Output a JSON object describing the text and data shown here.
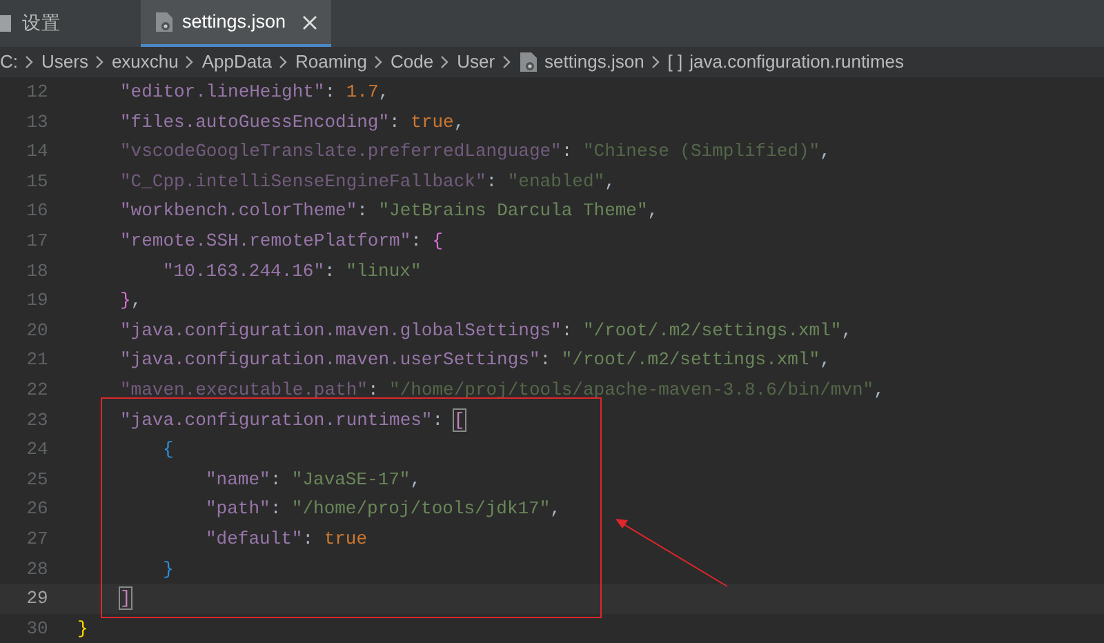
{
  "tabs": [
    {
      "label": "设置",
      "selected": false
    },
    {
      "label": "settings.json",
      "selected": true
    }
  ],
  "breadcrumb": [
    {
      "kind": "text",
      "label": "C:"
    },
    {
      "kind": "text",
      "label": "Users"
    },
    {
      "kind": "text",
      "label": "exuxchu"
    },
    {
      "kind": "text",
      "label": "AppData"
    },
    {
      "kind": "text",
      "label": "Roaming"
    },
    {
      "kind": "text",
      "label": "Code"
    },
    {
      "kind": "text",
      "label": "User"
    },
    {
      "kind": "file",
      "label": "settings.json"
    },
    {
      "kind": "symbol",
      "symbol": "[ ]",
      "label": "java.configuration.runtimes"
    }
  ],
  "editor": {
    "lines": [
      {
        "number": "12",
        "current": false,
        "tokens": [
          {
            "kind": "key",
            "text": "\"editor.lineHeight\""
          },
          {
            "kind": "punct",
            "text": ": "
          },
          {
            "kind": "number",
            "text": "1.7"
          },
          {
            "kind": "punct",
            "text": ","
          }
        ]
      },
      {
        "number": "13",
        "current": false,
        "tokens": [
          {
            "kind": "key",
            "text": "\"files.autoGuessEncoding\""
          },
          {
            "kind": "punct",
            "text": ": "
          },
          {
            "kind": "bool",
            "text": "true"
          },
          {
            "kind": "punct",
            "text": ","
          }
        ]
      },
      {
        "number": "14",
        "current": false,
        "dimmed": true,
        "tokens": [
          {
            "kind": "key",
            "text": "\"vscodeGoogleTranslate.preferredLanguage\""
          },
          {
            "kind": "punct",
            "text": ": "
          },
          {
            "kind": "string",
            "text": "\"Chinese (Simplified)\""
          },
          {
            "kind": "punct",
            "text": ","
          }
        ]
      },
      {
        "number": "15",
        "current": false,
        "dimmed": true,
        "tokens": [
          {
            "kind": "key",
            "text": "\"C_Cpp.intelliSenseEngineFallback\""
          },
          {
            "kind": "punct",
            "text": ": "
          },
          {
            "kind": "string",
            "text": "\"enabled\""
          },
          {
            "kind": "punct",
            "text": ","
          }
        ]
      },
      {
        "number": "16",
        "current": false,
        "tokens": [
          {
            "kind": "key",
            "text": "\"workbench.colorTheme\""
          },
          {
            "kind": "punct",
            "text": ": "
          },
          {
            "kind": "string",
            "text": "\"JetBrains Darcula Theme\""
          },
          {
            "kind": "punct",
            "text": ","
          }
        ]
      },
      {
        "number": "17",
        "current": false,
        "tokens": [
          {
            "kind": "key",
            "text": "\"remote.SSH.remotePlatform\""
          },
          {
            "kind": "punct",
            "text": ": "
          },
          {
            "kind": "open",
            "text": "{",
            "color": "#da70d6"
          }
        ]
      },
      {
        "number": "18",
        "current": false,
        "tokens": [
          {
            "kind": "key",
            "text": "\"10.163.244.16\""
          },
          {
            "kind": "punct",
            "text": ": "
          },
          {
            "kind": "string",
            "text": "\"linux\""
          }
        ]
      },
      {
        "number": "19",
        "current": false,
        "tokens": [
          {
            "kind": "close",
            "text": "}",
            "color": "#da70d6"
          },
          {
            "kind": "punct",
            "text": ","
          }
        ]
      },
      {
        "number": "20",
        "current": false,
        "tokens": [
          {
            "kind": "key",
            "text": "\"java.configuration.maven.globalSettings\""
          },
          {
            "kind": "punct",
            "text": ": "
          },
          {
            "kind": "string",
            "text": "\"/root/.m2/settings.xml\""
          },
          {
            "kind": "punct",
            "text": ","
          }
        ]
      },
      {
        "number": "21",
        "current": false,
        "tokens": [
          {
            "kind": "key",
            "text": "\"java.configuration.maven.userSettings\""
          },
          {
            "kind": "punct",
            "text": ": "
          },
          {
            "kind": "string",
            "text": "\"/root/.m2/settings.xml\""
          },
          {
            "kind": "punct",
            "text": ","
          }
        ]
      },
      {
        "number": "22",
        "current": false,
        "dimmed": true,
        "tokens": [
          {
            "kind": "key",
            "text": "\"maven.executable.path\""
          },
          {
            "kind": "punct",
            "text": ": "
          },
          {
            "kind": "string",
            "text": "\"/home/proj/tools/apache-maven-3.8.6/bin/mvn\""
          },
          {
            "kind": "punct",
            "text": ","
          }
        ]
      },
      {
        "number": "23",
        "current": false,
        "tokens": [
          {
            "kind": "key",
            "text": "\"java.configuration.runtimes\""
          },
          {
            "kind": "punct",
            "text": ": "
          },
          {
            "kind": "open",
            "text": "[",
            "color": "#c586c0",
            "matched": true
          }
        ]
      },
      {
        "number": "24",
        "current": false,
        "tokens": [
          {
            "kind": "open",
            "text": "{",
            "color": "#2f8fd6"
          }
        ]
      },
      {
        "number": "25",
        "current": false,
        "tokens": [
          {
            "kind": "key",
            "text": "\"name\""
          },
          {
            "kind": "punct",
            "text": ": "
          },
          {
            "kind": "string",
            "text": "\"JavaSE-17\""
          },
          {
            "kind": "punct",
            "text": ","
          }
        ]
      },
      {
        "number": "26",
        "current": false,
        "tokens": [
          {
            "kind": "key",
            "text": "\"path\""
          },
          {
            "kind": "punct",
            "text": ": "
          },
          {
            "kind": "string",
            "text": "\"/home/proj/tools/jdk17\""
          },
          {
            "kind": "punct",
            "text": ","
          }
        ]
      },
      {
        "number": "27",
        "current": false,
        "tokens": [
          {
            "kind": "key",
            "text": "\"default\""
          },
          {
            "kind": "punct",
            "text": ": "
          },
          {
            "kind": "bool",
            "text": "true"
          }
        ]
      },
      {
        "number": "28",
        "current": false,
        "tokens": [
          {
            "kind": "close",
            "text": "}",
            "color": "#2f8fd6"
          }
        ]
      },
      {
        "number": "29",
        "current": true,
        "tokens": [
          {
            "kind": "close",
            "text": "]",
            "color": "#c586c0",
            "matched": true
          }
        ]
      },
      {
        "number": "30",
        "current": false,
        "tokens": [
          {
            "kind": "close",
            "text": "}",
            "color": "#ffd700"
          }
        ]
      }
    ]
  }
}
